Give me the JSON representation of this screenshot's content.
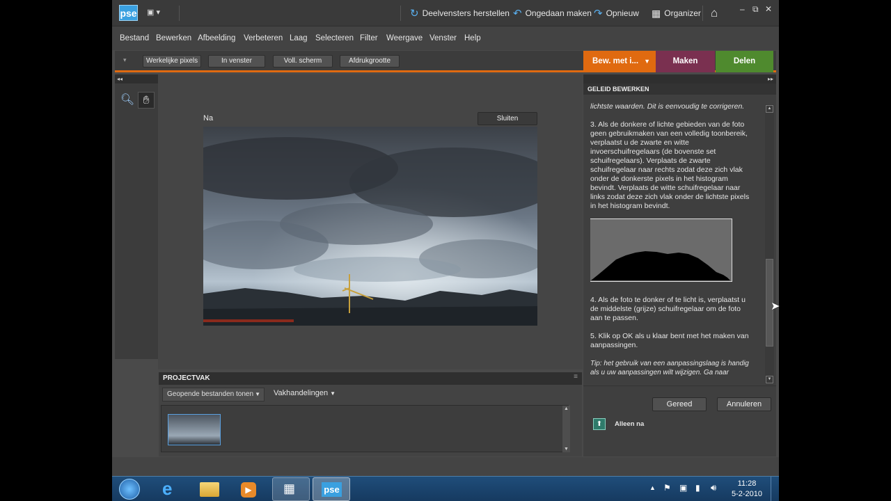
{
  "app": {
    "logo": "pse"
  },
  "titlebar": {
    "reset_panels": "Deelvensters herstellen",
    "undo": "Ongedaan maken",
    "redo": "Opnieuw",
    "organizer": "Organizer"
  },
  "menu": [
    "Bestand",
    "Bewerken",
    "Afbeelding",
    "Verbeteren",
    "Laag",
    "Selecteren",
    "Filter",
    "Weergave",
    "Venster",
    "Help"
  ],
  "options": {
    "actual_pixels": "Werkelijke pixels",
    "fit_window": "In venster",
    "full_screen": "Voll. scherm",
    "print_size": "Afdrukgrootte"
  },
  "modes": {
    "edit": "Bew. met i...",
    "create": "Maken",
    "share": "Delen"
  },
  "canvas": {
    "after_label": "Na",
    "close_label": "Sluiten"
  },
  "project": {
    "title": "PROJECTVAK",
    "show_dropdown": "Geopende bestanden tonen",
    "bin_actions": "Vakhandelingen"
  },
  "guided": {
    "title": "GELEID BEWERKEN",
    "partial_top": "lichtste waarden. Dit is eenvoudig te corrigeren.",
    "step3": "3. Als de donkere of lichte gebieden van de foto geen gebruikmaken van een volledig toonbereik, verplaatst u de zwarte en witte invoerschuifregelaars (de bovenste set schuifregelaars). Verplaats de zwarte schuifregelaar naar rechts zodat deze zich vlak onder de donkerste pixels in het histogram bevindt. Verplaats de witte schuifregelaar naar links zodat deze zich vlak onder de lichtste pixels in het histogram bevindt.",
    "step4": "4. Als de foto te donker of te licht is, verplaatst u de middelste (grijze) schuifregelaar om de foto aan te passen.",
    "step5": "5. Klik op OK als u klaar bent met het maken van aanpassingen.",
    "tip": "Tip: het gebruik van een aanpassingslaag is handig als u uw aanpassingen wilt wijzigen. Ga naar",
    "ok": "Gereed",
    "cancel": "Annuleren",
    "after_only": "Alleen na"
  },
  "clock": {
    "time": "11:28",
    "date": "5-2-2010"
  },
  "colors": {
    "accent_orange": "#e06a10",
    "create_tab": "#7a3050",
    "share_tab": "#4f8a2e",
    "brand_blue": "#3aa0e0"
  }
}
